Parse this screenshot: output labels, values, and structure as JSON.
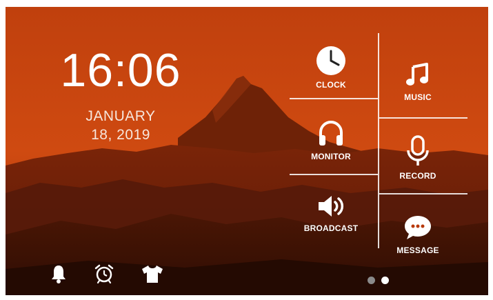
{
  "time": "16:06",
  "date": {
    "month": "JANUARY",
    "day_year": "18, 2019"
  },
  "tiles": [
    {
      "label": "CLOCK",
      "icon": "clock-icon"
    },
    {
      "label": "MUSIC",
      "icon": "music-note-icon"
    },
    {
      "label": "MONITOR",
      "icon": "headphones-icon"
    },
    {
      "label": "RECORD",
      "icon": "microphone-icon"
    },
    {
      "label": "BROADCAST",
      "icon": "speaker-icon"
    },
    {
      "label": "MESSAGE",
      "icon": "chat-bubble-icon"
    }
  ],
  "bottom_bar": [
    {
      "icon": "bell-icon"
    },
    {
      "icon": "alarm-clock-icon"
    },
    {
      "icon": "shirt-icon"
    }
  ],
  "pager": {
    "pages": 2,
    "active_page": 2
  },
  "colors": {
    "background_accent": "#c9450f",
    "text": "#ffffff",
    "dot_inactive": "#8a8a8a",
    "dot_active": "#ffffff"
  }
}
